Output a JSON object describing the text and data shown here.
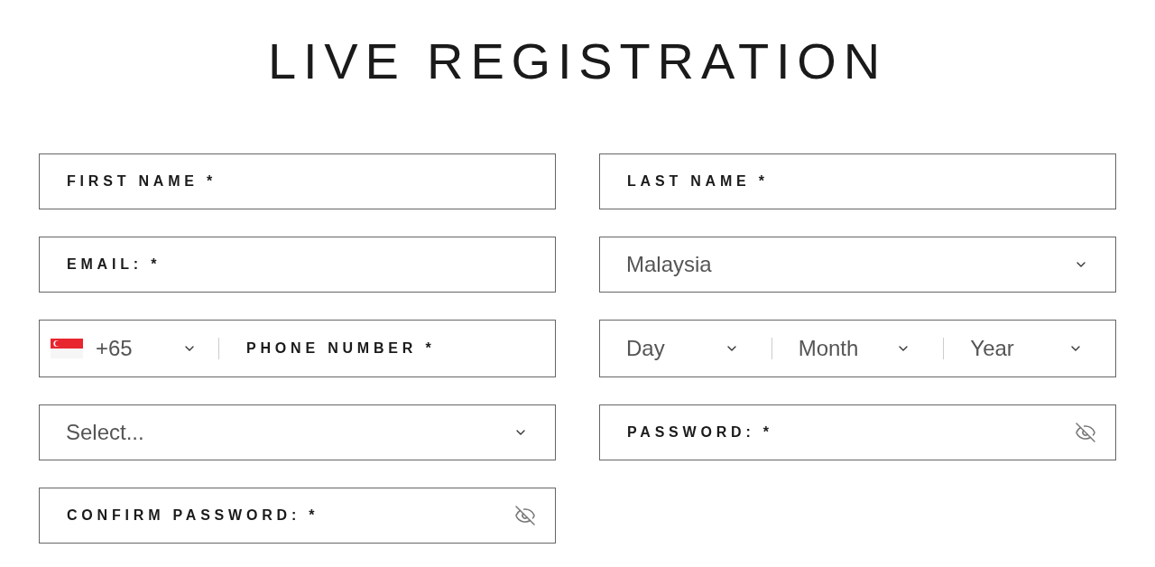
{
  "title": "LIVE REGISTRATION",
  "fields": [
    {
      "kind": "text",
      "placeholder": "FIRST NAME *"
    },
    {
      "kind": "text",
      "placeholder": "LAST NAME *"
    },
    {
      "kind": "text",
      "placeholder": "EMAIL: *"
    },
    {
      "kind": "select",
      "value": "Malaysia"
    },
    {
      "kind": "phone",
      "country_code": "+65",
      "placeholder": "PHONE NUMBER *"
    },
    {
      "kind": "date",
      "parts": [
        "Day",
        "Month",
        "Year"
      ]
    },
    {
      "kind": "select",
      "value": "Select..."
    },
    {
      "kind": "password",
      "placeholder": "PASSWORD: *"
    },
    {
      "kind": "password",
      "placeholder": "CONFIRM PASSWORD: *"
    }
  ]
}
